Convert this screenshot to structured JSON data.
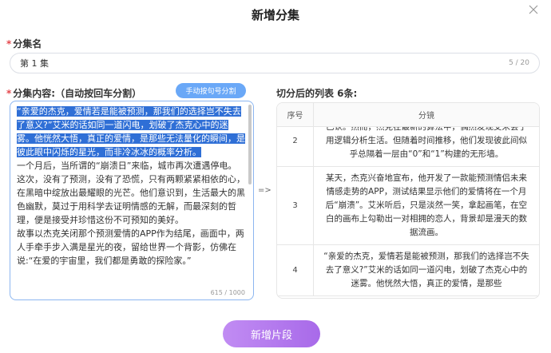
{
  "dialog": {
    "title": "新增分集"
  },
  "name_field": {
    "label": "分集名",
    "value": "第 1 集",
    "counter": "5 / 20"
  },
  "content_field": {
    "label": "分集内容:（自动按回车分割）",
    "split_button": "手动按句号分割",
    "selected_text": "“亲爱的杰克，爱情若是能被预测，那我们的选择岂不失去了意义?”艾米的话如同一道闪电，划破了杰克心中的迷雾。他恍然大悟，真正的爱情，是那些无法量化的瞬间，是彼此眼中闪烁的星光，而非冷冰冰的概率分析。",
    "rest_text": "\n一个月后，当所谓的“崩溃日”来临，城市再次遭遇停电。这次，没有了预测，没有了恐慌，只有两颗紧紧相依的心，在黑暗中绽放出最耀眼的光芒。他们意识到，生活最大的黑色幽默，莫过于用科学去证明情感的无解，而最深刻的哲理，便是接受并珍惜这份不可预知的美好。\n故事以杰克关闭那个预测爱情的APP作为结尾，画面中，两人手牵手步入满是星光的夜，留给世界一个背影，仿佛在说:“在爱的宇宙里，我们都是勇敢的探险家。”",
    "counter": "615 / 1000"
  },
  "arrow_text": "=>",
  "result": {
    "label": "切分后的列表 6条:",
    "columns": [
      "序号",
      "分镜"
    ],
    "rows": [
      {
        "index": "2",
        "text": "已认。然而，杰克在最新的算法中，偶然发现艾米会了用逻辑分析生活。但随着时间推移，他们发现彼此间似乎总隔着一层由“0”和“1”构建的无形墙。"
      },
      {
        "index": "3",
        "text": "某天，杰克兴奋地宣布，他开发了一款能预测情侣未来情感走势的APP，测试结果显示他们的爱情将在一个月后“崩溃”。艾米听后，只是淡然一笑，拿起画笔，在空白的画布上勾勒出一对相拥的恋人，背景却是漫天的数据流画。"
      },
      {
        "index": "4",
        "text": "“亲爱的杰克，爱情若是能被预测，那我们的选择岂不失去了意义?”艾米的话如同一道闪电，划破了杰克心中的迷雾。他恍然大悟，真正的爱情，是那些"
      }
    ]
  },
  "add_button": "新增片段",
  "colors": {
    "accent_blue": "#6aa8f7",
    "selection": "#2f6fd6",
    "add_button": "#b57bef",
    "required": "#e5484d"
  }
}
